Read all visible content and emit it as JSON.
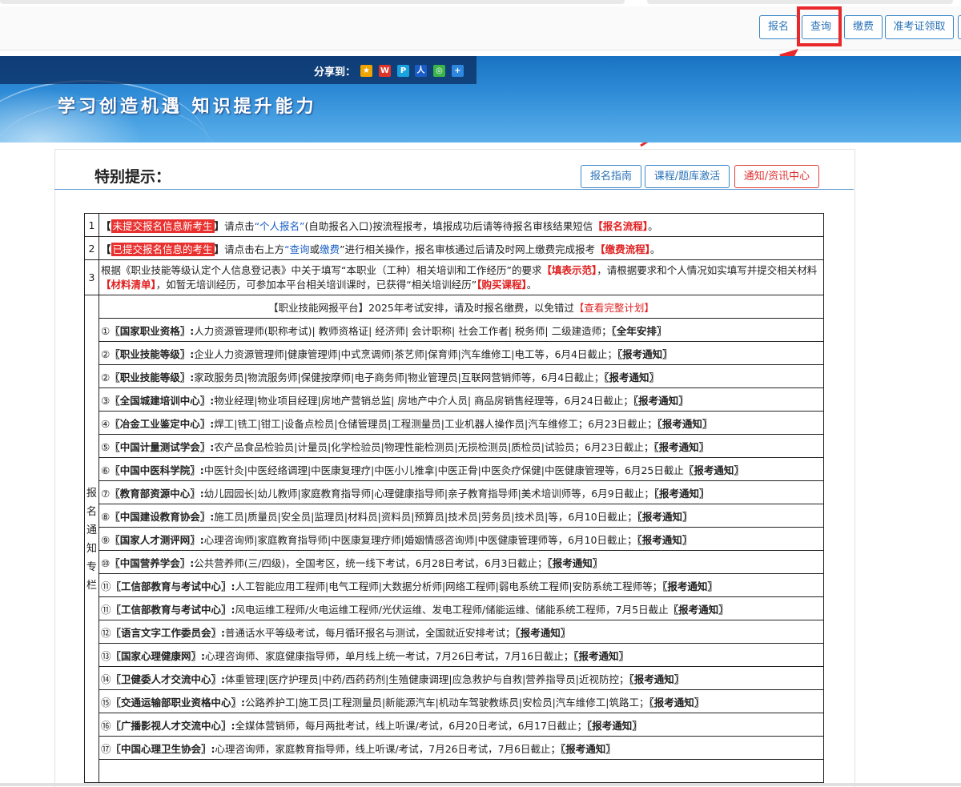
{
  "header": {
    "buttons": [
      "报名",
      "查询",
      "缴费",
      "准考证领取"
    ]
  },
  "banner": {
    "share_label": "分享到：",
    "slogan": "学习创造机遇  知识提升能力"
  },
  "panel": {
    "title": "特别提示：",
    "buttons": [
      "报名指南",
      "课程/题库激活",
      "通知/资讯中心"
    ]
  },
  "notices": [
    {
      "num": "1",
      "tag": "未提交报名信息新考生",
      "b1": "【",
      "b2": "】",
      "t1": "请点击",
      "link1": "“个人报名”",
      "t2": "(自助报名入口)按流程报考，填报成功后请等待报名审核结果短信",
      "link2": "【报名流程】",
      "t3": "。"
    },
    {
      "num": "2",
      "tag": "已提交报名信息的考生",
      "b1": "【",
      "b2": "】",
      "t1": "请点击右上方",
      "link1": "“查询",
      "t_or": "或",
      "link1b": "缴费",
      "t2": "”进行相关操作，报名审核通过后请及时网上缴费完成报考",
      "link2": "【缴费流程】",
      "t3": "。"
    },
    {
      "num": "3",
      "t1": "根据《职业技能等级认定个人信息登记表》中关于填写“本职业（工种）相关培训和工作经历”的要求",
      "link1": "【填表示范】",
      "t2": "，请根据要求和个人情况如实填写并提交相关材料",
      "link2": "【材料清单】",
      "t3": "，如暂无培训经历，可参加本平台相关培训课时，已获得“相关培训经历”",
      "link3": "【购买课程】",
      "t4": "。"
    }
  ],
  "sidebar_label": [
    "报",
    "名",
    "通",
    "知",
    "专",
    "栏"
  ],
  "section_header": {
    "t1": "【职业技能网报平台】2025年考试安排，请及时报名缴费，以免错过",
    "link": "【查看完整计划】"
  },
  "sections": [
    {
      "mark": "①",
      "org": "〖国家职业资格〗:",
      "text": "人力资源管理师(职称考试)| 教师资格证| 经济师| 会计职称| 社会工作者|  税务师| 二级建造师；",
      "tail": "〖全年安排〗"
    },
    {
      "mark": "②",
      "org": "〖职业技能等级〗:",
      "text": "企业人力资源管理师|健康管理师|中式烹调师|茶艺师|保育师|汽车维修工|电工等，6月4日截止；",
      "tail": "〖报考通知〗"
    },
    {
      "mark": "②",
      "org": "〖职业技能等级〗:",
      "text": "家政服务员|物流服务师|保健按摩师|电子商务师|物业管理员|互联网营销师等，6月4日截止；",
      "tail": "〖报考通知〗"
    },
    {
      "mark": "③",
      "org": "〖全国城建培训中心〗:",
      "text": "物业经理|物业项目经理|房地产营销总监| 房地产中介人员| 商品房销售经理等，6月24日截止；",
      "tail": "〖报考通知〗"
    },
    {
      "mark": "④",
      "org": "〖冶金工业鉴定中心〗:",
      "text": "焊工|铣工|钳工|设备点检员|仓储管理员|工程测量员|工业机器人操作员|汽车维修工；6月23日截止；",
      "tail": "〖报考通知〗"
    },
    {
      "mark": "⑤",
      "org": "〖中国计量测试学会〗:",
      "text": "农产品食品检验员|计量员|化学检验员|物理性能检测员|无损检测员|质检员|试验员；6月23日截止；",
      "tail": "〖报考通知〗"
    },
    {
      "mark": "⑥",
      "org": "〖中国中医科学院〗:",
      "text": "中医针灸|中医经络调理|中医康复理疗|中医小儿推拿|中医正骨|中医灸疗保健|中医健康管理等，6月25日截止",
      "tail": "〖报考通知〗"
    },
    {
      "mark": "⑦",
      "org": "〖教育部资源中心〗:",
      "text": "幼儿园园长|幼儿教师|家庭教育指导师|心理健康指导师|亲子教育指导师|美术培训师等，6月9日截止；",
      "tail": "〖报考通知〗"
    },
    {
      "mark": "⑧",
      "org": "〖中国建设教育协会〗:",
      "text": "施工员|质量员|安全员|监理员|材料员|资料员|预算员|技术员|劳务员|技术员|等，6月10日截止；",
      "tail": "〖报考通知〗"
    },
    {
      "mark": "⑨",
      "org": "〖国家人才测评网〗:",
      "text": "心理咨询师|家庭教育指导师|中医康复理疗师|婚姻情感咨询师|中医健康管理师等，6月10日截止；",
      "tail": "〖报考通知〗"
    },
    {
      "mark": "⑩",
      "org": "〖中国营养学会〗:",
      "text": "公共营养师(三/四级)，全国考区，统一线下考试，6月28日考试，6月3日截止；",
      "tail": "〖报考通知〗"
    },
    {
      "mark": "⑪",
      "org": "〖工信部教育与考试中心〗:",
      "text": "人工智能应用工程师|电气工程师|大数据分析师|网络工程师|弱电系统工程师|安防系统工程师等；",
      "tail": "〖报考通知〗"
    },
    {
      "mark": "⑪",
      "org": "〖工信部教育与考试中心〗:",
      "text": "风电运维工程师/火电运维工程师/光伏运维、发电工程师/储能运维、储能系统工程师，7月5日截止",
      "tail": "〖报考通知〗"
    },
    {
      "mark": "⑫",
      "org": "〖语言文字工作委员会〗:",
      "text": "普通话水平等级考试，每月循环报名与测试，全国就近安排考试；",
      "tail": "〖报考通知〗"
    },
    {
      "mark": "⑬",
      "org": "〖国家心理健康网〗:",
      "text": "心理咨询师、家庭健康指导师，单月线上统一考试，7月26日考试，7月16日截止；",
      "tail": "〖报考通知〗"
    },
    {
      "mark": "⑭",
      "org": "〖卫健委人才交流中心〗:",
      "text": "体重管理|医疗护理员|中药/西药药剂|生殖健康调理|应急救护与自救|营养指导员|近视防控；",
      "tail": "〖报考通知〗"
    },
    {
      "mark": "⑮",
      "org": "〖交通运输部职业资格中心〗:",
      "text": "公路养护工|施工员|工程测量员|新能源汽车|机动车驾驶教练员|安检员|汽车维修工|筑路工；",
      "tail": "〖报考通知〗"
    },
    {
      "mark": "⑯",
      "org": "〖广播影视人才交流中心〗:",
      "text": "全媒体营销师，每月两批考试，线上听课/考试，6月20日考试，6月17日截止；",
      "tail": "〖报考通知〗"
    },
    {
      "mark": "⑰",
      "org": "〖中国心理卫生协会〗:",
      "text": "心理咨询师，家庭教育指导师，线上听课/考试，7月26日考试，7月6日截止；",
      "tail": "〖报考通知〗"
    }
  ],
  "colors": {
    "accent_blue": "#2a73b8",
    "highlight_red": "#e8282b",
    "tag_red": "#e8302e"
  }
}
